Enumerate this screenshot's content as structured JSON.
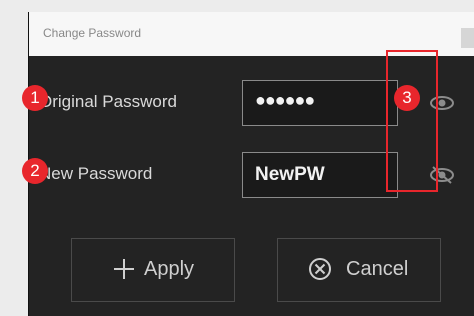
{
  "dialog": {
    "title": "Change Password",
    "fields": [
      {
        "label": "Original Password",
        "value": "●●●●●●",
        "reveal_icon": "eye-icon"
      },
      {
        "label": "New Password",
        "value": "NewPW",
        "reveal_icon": "eye-slash-icon"
      }
    ],
    "buttons": {
      "apply_label": "Apply",
      "apply_icon": "plus-icon",
      "cancel_label": "Cancel",
      "cancel_icon": "circle-x-icon"
    }
  },
  "callouts": {
    "one": "1",
    "two": "2",
    "three": "3",
    "color": "#e8262c"
  }
}
